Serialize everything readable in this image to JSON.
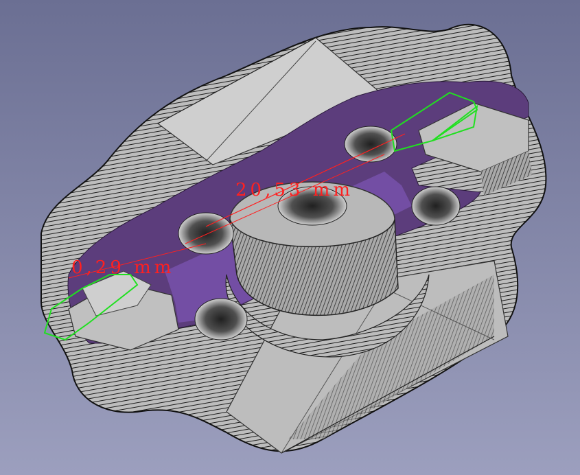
{
  "viewport": {
    "background_top": "#6b6f93",
    "background_bottom": "#9c9fbe"
  },
  "colors": {
    "part_face": "#c8c8c8",
    "part_shadow": "#4a4a4a",
    "part_dark": "#202020",
    "section_cut": "#5c3d7c",
    "section_cut_light": "#7650a8",
    "dimension": "#ff2020",
    "hex_outline": "#20e020"
  },
  "annotations": {
    "dim_long": "20,53 mm",
    "dim_short": "0,29 mm"
  },
  "icons": {
    "model": "3d-part-section-icon"
  }
}
